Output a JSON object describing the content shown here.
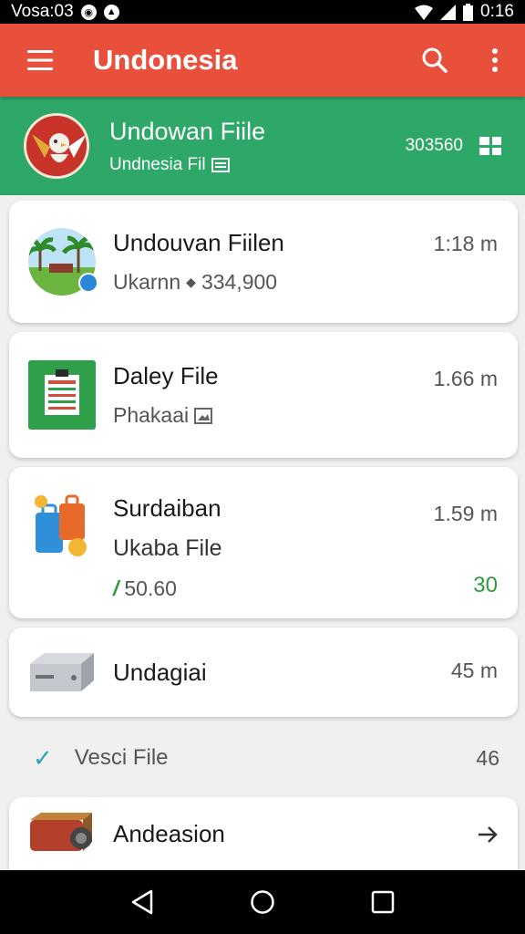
{
  "status_bar": {
    "time_left": "Vosa:03",
    "time_right": "0:16"
  },
  "app_bar": {
    "title": "Undonesia"
  },
  "banner": {
    "title": "Undowan Fiile",
    "subtitle": "Undnesia Fil",
    "code": "303560"
  },
  "items": [
    {
      "name": "Undouvan Fiilen",
      "sub_label": "Ukarnn",
      "sub_value": "334,900",
      "meta": "1:18 m"
    },
    {
      "name": "Daley File",
      "sub_label": "Phakaai",
      "meta": "1.66 m"
    },
    {
      "name": "Surdaiban",
      "sub_label": "Ukaba File",
      "price": "50.60",
      "meta": "1.59 m",
      "count": "30"
    },
    {
      "name": "Undagiai",
      "meta": "45 m"
    },
    {
      "name": "Vesci File",
      "meta": "46"
    },
    {
      "name": "Andeasion"
    }
  ],
  "colors": {
    "app_bar": "#e9503b",
    "banner": "#2ea868",
    "accent_green": "#2e9b3c"
  }
}
